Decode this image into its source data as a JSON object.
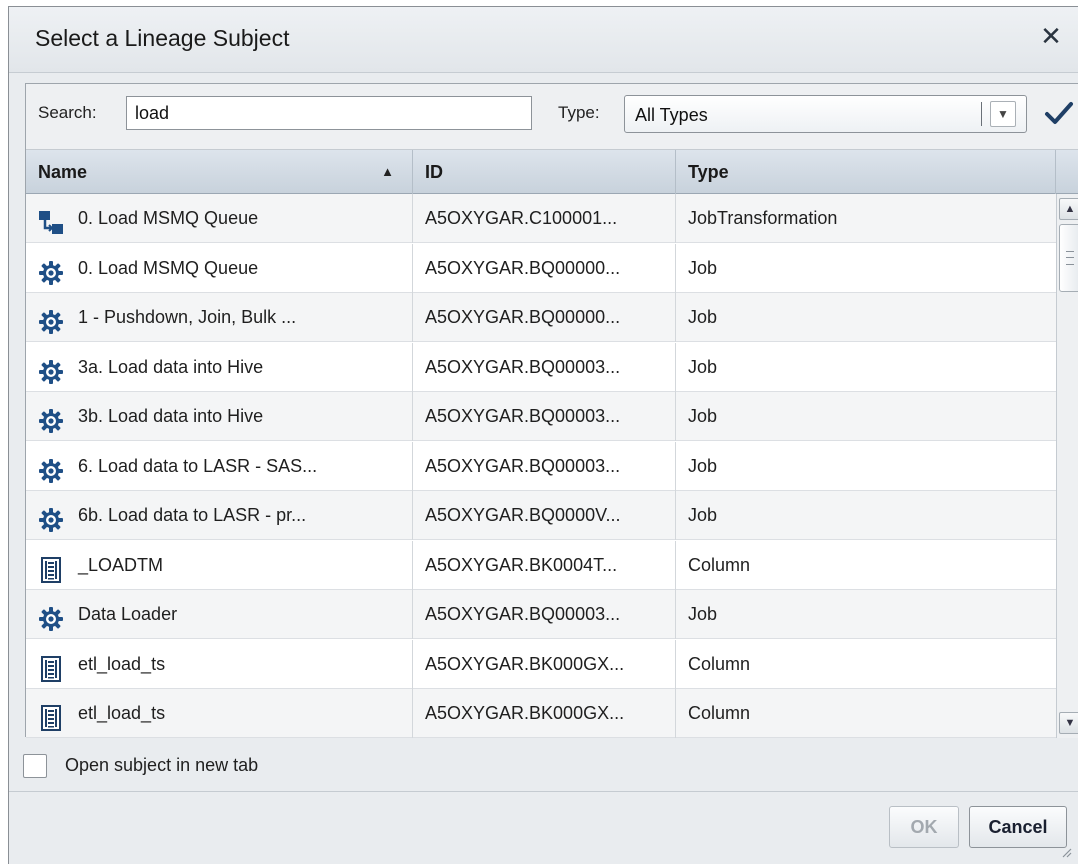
{
  "dialog": {
    "title": "Select a Lineage Subject",
    "close_glyph": "✕"
  },
  "search": {
    "label": "Search:",
    "value": "load"
  },
  "type_filter": {
    "label": "Type:",
    "selected": "All Types",
    "arrow_glyph": "▼"
  },
  "apply_icon": "checkmark-icon",
  "columns": {
    "name": "Name",
    "id": "ID",
    "type": "Type",
    "sort_glyph": "▲"
  },
  "rows": [
    {
      "icon": "transformation-icon",
      "name": "0. Load MSMQ Queue",
      "id": "A5OXYGAR.C100001...",
      "type": "JobTransformation"
    },
    {
      "icon": "gear-icon",
      "name": "0. Load MSMQ Queue",
      "id": "A5OXYGAR.BQ00000...",
      "type": "Job"
    },
    {
      "icon": "gear-icon",
      "name": "1 - Pushdown, Join,  Bulk ...",
      "id": "A5OXYGAR.BQ00000...",
      "type": "Job"
    },
    {
      "icon": "gear-icon",
      "name": "3a. Load data into Hive",
      "id": "A5OXYGAR.BQ00003...",
      "type": "Job"
    },
    {
      "icon": "gear-icon",
      "name": "3b. Load data into Hive",
      "id": "A5OXYGAR.BQ00003...",
      "type": "Job"
    },
    {
      "icon": "gear-icon",
      "name": "6. Load data to LASR - SAS...",
      "id": "A5OXYGAR.BQ00003...",
      "type": "Job"
    },
    {
      "icon": "gear-icon",
      "name": "6b. Load data to LASR - pr...",
      "id": "A5OXYGAR.BQ0000V...",
      "type": "Job"
    },
    {
      "icon": "column-icon",
      "name": "_LOADTM",
      "id": "A5OXYGAR.BK0004T...",
      "type": "Column"
    },
    {
      "icon": "gear-icon",
      "name": "Data Loader",
      "id": "A5OXYGAR.BQ00003...",
      "type": "Job"
    },
    {
      "icon": "column-icon",
      "name": "etl_load_ts",
      "id": "A5OXYGAR.BK000GX...",
      "type": "Column"
    },
    {
      "icon": "column-icon",
      "name": "etl_load_ts",
      "id": "A5OXYGAR.BK000GX...",
      "type": "Column"
    }
  ],
  "scrollbar": {
    "up_glyph": "▲",
    "down_glyph": "▼"
  },
  "open_in_new_tab": {
    "label": "Open subject in new tab",
    "checked": false
  },
  "buttons": {
    "ok": "OK",
    "cancel": "Cancel"
  },
  "colors": {
    "icon_blue": "#1f4f86",
    "checkmark": "#1f3f66",
    "disabled_text": "#a3a9af"
  }
}
